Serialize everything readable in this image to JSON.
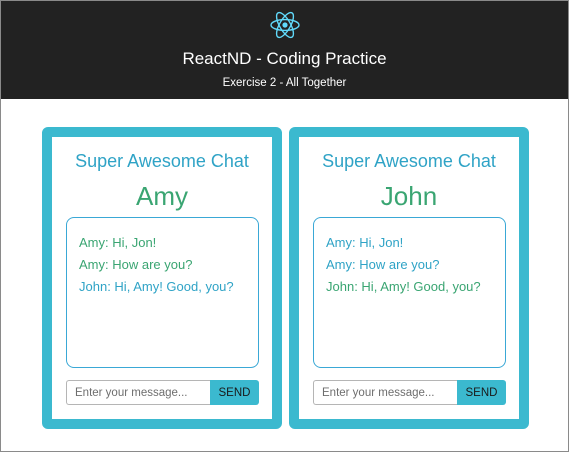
{
  "header": {
    "logo_icon": "react-atom-icon",
    "title": "ReactND - Coding Practice",
    "subtitle": "Exercise 2 - All Together"
  },
  "colors": {
    "header_bg": "#222222",
    "accent": "#3bb9cf",
    "heading_blue": "#2fa3c6",
    "user_green": "#3aa572"
  },
  "chats": [
    {
      "heading": "Super Awesome Chat",
      "user": "Amy",
      "messages": [
        {
          "sender": "Amy",
          "text": "Amy: Hi, Jon!"
        },
        {
          "sender": "Amy",
          "text": "Amy: How are you?"
        },
        {
          "sender": "John",
          "text": "John: Hi, Amy! Good, you?"
        }
      ],
      "input_placeholder": "Enter your message...",
      "send_label": "SEND"
    },
    {
      "heading": "Super Awesome Chat",
      "user": "John",
      "messages": [
        {
          "sender": "Amy",
          "text": "Amy: Hi, Jon!"
        },
        {
          "sender": "Amy",
          "text": "Amy: How are you?"
        },
        {
          "sender": "John",
          "text": "John: Hi, Amy! Good, you?"
        }
      ],
      "input_placeholder": "Enter your message...",
      "send_label": "SEND"
    }
  ]
}
